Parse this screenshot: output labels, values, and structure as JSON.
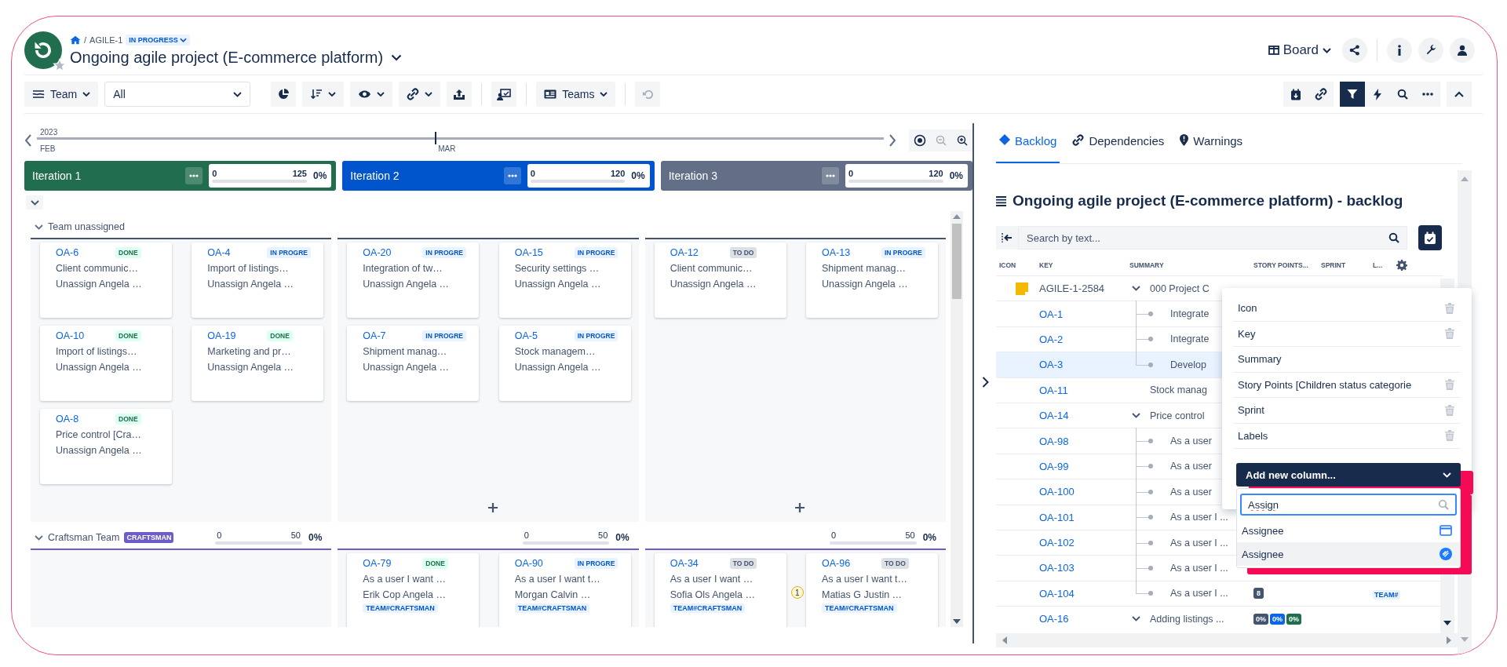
{
  "header": {
    "separator": "/",
    "project_key": "AGILE-1",
    "status": "IN PROGRESS",
    "title": "Ongoing agile project (E-commerce platform)",
    "view_button": "Board"
  },
  "toolbar": {
    "group_by": "Team",
    "filter_value": "All",
    "teams_button": "Teams",
    "filter_active": true
  },
  "timeline": {
    "year": "2023",
    "months": [
      "FEB",
      "MAR"
    ]
  },
  "iterations": [
    {
      "name": "Iteration 1",
      "color": "#216e4e",
      "min": "0",
      "max": "125",
      "percent": "0%",
      "level": 0
    },
    {
      "name": "Iteration 2",
      "color": "#0055cc",
      "min": "0",
      "max": "120",
      "percent": "0%",
      "level": 0
    },
    {
      "name": "Iteration 3",
      "color": "#626f86",
      "min": "0",
      "max": "120",
      "percent": "0%",
      "level": 0
    }
  ],
  "lanes": [
    {
      "name": "Team unassigned",
      "expanded": true,
      "color": "#44546f",
      "columns": [
        {
          "can_add": false,
          "cards": [
            {
              "key": "OA-6",
              "status": "DONE",
              "kind": "done",
              "summary": "Client communic…",
              "assignee": "Unassign Angela …"
            },
            {
              "key": "OA-4",
              "status": "IN PROGRE",
              "kind": "progress",
              "summary": "Import of listings…",
              "assignee": "Unassign Angela …"
            },
            {
              "key": "OA-10",
              "status": "DONE",
              "kind": "done",
              "summary": "Import of listings…",
              "assignee": "Unassign Angela …"
            },
            {
              "key": "OA-19",
              "status": "DONE",
              "kind": "done",
              "summary": "Marketing and pr…",
              "assignee": "Unassign Angela …"
            },
            {
              "key": "OA-8",
              "status": "DONE",
              "kind": "done",
              "summary": "Price control [Cra…",
              "assignee": "Unassign Angela …"
            }
          ]
        },
        {
          "can_add": true,
          "cards": [
            {
              "key": "OA-20",
              "status": "IN PROGRE",
              "kind": "progress",
              "summary": "Integration of tw…",
              "assignee": "Unassign Angela …"
            },
            {
              "key": "OA-15",
              "status": "IN PROGRE",
              "kind": "progress",
              "summary": "Security settings …",
              "assignee": "Unassign Angela …"
            },
            {
              "key": "OA-7",
              "status": "IN PROGRE",
              "kind": "progress",
              "summary": "Shipment manag…",
              "assignee": "Unassign Angela …"
            },
            {
              "key": "OA-5",
              "status": "IN PROGRE",
              "kind": "progress",
              "summary": "Stock managem…",
              "assignee": "Unassign Angela …"
            }
          ]
        },
        {
          "can_add": true,
          "cards": [
            {
              "key": "OA-12",
              "status": "TO DO",
              "kind": "todo",
              "summary": "Client communic…",
              "assignee": "Unassign Angela …"
            },
            {
              "key": "OA-13",
              "status": "IN PROGRE",
              "kind": "progress",
              "summary": "Shipment manag…",
              "assignee": "Unassign Angela …"
            }
          ]
        }
      ]
    },
    {
      "name": "Craftsman Team",
      "badge": "CRAFTSMAN",
      "expanded": true,
      "color": "#6e5dc6",
      "columns": [
        {
          "capacity": {
            "min": "0",
            "max": "50",
            "percent": "0%",
            "level": 0
          }
        },
        {
          "capacity": {
            "min": "0",
            "max": "50",
            "percent": "0%",
            "level": 0
          },
          "cards": [
            {
              "key": "OA-79",
              "status": "DONE",
              "kind": "done",
              "summary": "As a user I want …",
              "assignee": "Erik Cop Angela …",
              "label": "TEAM#CRAFTSMAN"
            },
            {
              "key": "OA-90",
              "status": "IN PROGRE",
              "kind": "progress",
              "summary": "As a user I want t…",
              "assignee": "Morgan Calvin …",
              "label": "TEAM#CRAFTSMAN"
            }
          ]
        },
        {
          "capacity": {
            "min": "0",
            "max": "50",
            "percent": "0%",
            "level": 0
          },
          "cards": [
            {
              "key": "OA-34",
              "status": "TO DO",
              "kind": "todo",
              "summary": "As a user I want …",
              "assignee": "Sofia Ols Angela …",
              "label": "TEAM#CRAFTSMAN",
              "warnings": "1"
            },
            {
              "key": "OA-96",
              "status": "TO DO",
              "kind": "todo",
              "summary": "As a user I want t…",
              "assignee": "Matias G Justin …",
              "label": "TEAM#CRAFTSMAN"
            }
          ]
        }
      ]
    }
  ],
  "backlog": {
    "tabs": [
      {
        "label": "Backlog",
        "kind": "diamond",
        "selected": true
      },
      {
        "label": "Dependencies",
        "kind": "link",
        "selected": false
      },
      {
        "label": "Warnings",
        "kind": "pin",
        "selected": false
      }
    ],
    "title": "Ongoing agile project (E-commerce platform) - backlog",
    "search_placeholder": "Search by text...",
    "columns": [
      "ICON",
      "KEY",
      "SUMMARY",
      "STORY POINTS...",
      "SPRINT",
      "L..."
    ],
    "rows": [
      {
        "key": "AGILE-1-2584",
        "kind": "epic",
        "summary": "000 Project C",
        "expanded": true,
        "selected": false,
        "children": [
          {
            "key": "OA-1",
            "summary": "Integrate",
            "selected": false
          },
          {
            "key": "OA-2",
            "summary": "Integrate",
            "selected": false
          },
          {
            "key": "OA-3",
            "summary": "Develop",
            "selected": true
          }
        ]
      },
      {
        "key": "OA-11",
        "kind": "issue",
        "summary": "Stock manag",
        "selected": false
      },
      {
        "key": "OA-14",
        "kind": "issue",
        "summary": "Price control",
        "expanded": true,
        "selected": false,
        "children": [
          {
            "key": "OA-98",
            "summary": "As a user",
            "selected": false
          },
          {
            "key": "OA-99",
            "summary": "As a user",
            "selected": false
          },
          {
            "key": "OA-100",
            "summary": "As a user",
            "selected": false
          },
          {
            "key": "OA-101",
            "summary": "As a user I ...",
            "selected": false
          },
          {
            "key": "OA-102",
            "summary": "As a user I ...",
            "selected": false
          },
          {
            "key": "OA-103",
            "summary": "As a user I ...",
            "selected": false
          },
          {
            "key": "OA-104",
            "summary": "As a user I ...",
            "story_points": "8",
            "label": "TEAM#",
            "selected": false
          }
        ]
      },
      {
        "key": "OA-16",
        "kind": "issue",
        "summary": "Adding listings ...",
        "expanded": true,
        "selected": false,
        "progress": [
          {
            "text": "0%",
            "color": "#44546f"
          },
          {
            "text": "0%",
            "color": "#0c66e4"
          },
          {
            "text": "0%",
            "color": "#216e4e"
          }
        ]
      }
    ],
    "column_settings": {
      "columns": [
        {
          "name": "Icon",
          "removable": true
        },
        {
          "name": "Key",
          "removable": true
        },
        {
          "name": "Summary",
          "removable": false
        },
        {
          "name": "Story Points [Children status categorie",
          "removable": true
        },
        {
          "name": "Sprint",
          "removable": true
        },
        {
          "name": "Labels",
          "removable": true
        }
      ],
      "add_select": "Add new column...",
      "search_value": "Assign",
      "options": [
        {
          "label": "Assignee",
          "kind": "calendar",
          "selected": false
        },
        {
          "label": "Assignee",
          "kind": "round",
          "selected": true
        }
      ]
    }
  }
}
